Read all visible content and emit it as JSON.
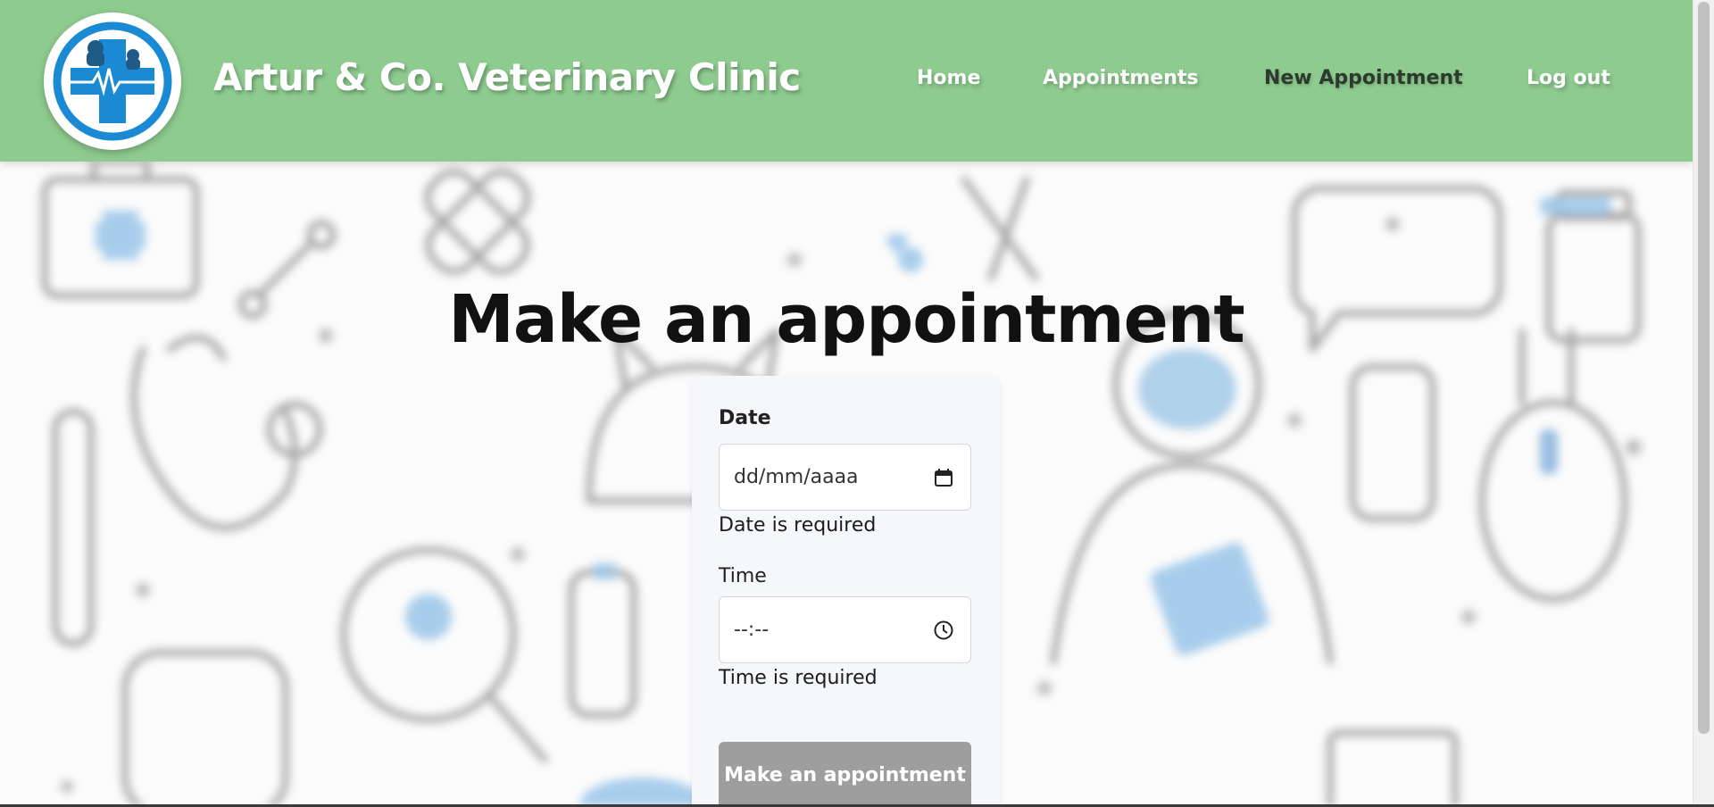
{
  "header": {
    "brand": "Artur & Co. Veterinary Clinic",
    "nav": [
      {
        "label": "Home"
      },
      {
        "label": "Appointments"
      },
      {
        "label": "New Appointment",
        "active": true
      },
      {
        "label": "Log out"
      }
    ]
  },
  "main": {
    "title": "Make an appointment",
    "form": {
      "date": {
        "label": "Date",
        "placeholder": "dd/mm/aaaa",
        "error": "Date is required"
      },
      "time": {
        "label": "Time",
        "placeholder": "--:--",
        "error": "Time is required"
      },
      "submit_label": "Make an appointment"
    }
  },
  "colors": {
    "header_bg": "#8ecb8f",
    "submit_bg": "#9e9e9e",
    "card_bg": "#f5f7fb",
    "logo_blue": "#1a8ad4"
  },
  "icons": [
    "clinic-logo",
    "calendar-icon",
    "clock-icon"
  ]
}
